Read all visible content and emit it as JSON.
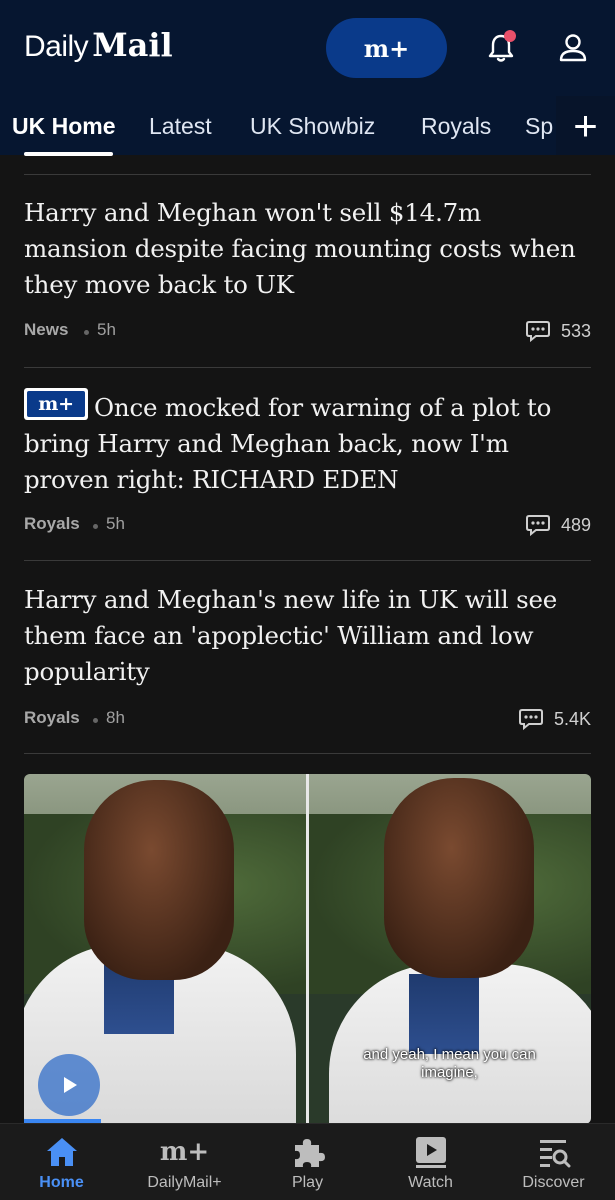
{
  "header": {
    "logo_daily": "Daily",
    "logo_mail": "Mail",
    "mplus_label": "m+"
  },
  "tabs": [
    {
      "label": "UK Home",
      "active": true
    },
    {
      "label": "Latest"
    },
    {
      "label": "UK Showbiz"
    },
    {
      "label": "Royals"
    },
    {
      "label": "Sp"
    }
  ],
  "add_tab_label": "+",
  "articles": [
    {
      "headline": "Harry and Meghan won't sell $14.7m mansion despite facing mounting costs when they move back to UK",
      "category": "News",
      "time": "5h",
      "comments": "533",
      "premium": false
    },
    {
      "badge": "m+",
      "headline": "Once mocked for warning of a plot to bring Harry and Meghan back, now I'm proven right: RICHARD EDEN",
      "category": "Royals",
      "time": "5h",
      "comments": "489",
      "premium": true
    },
    {
      "headline": "Harry and Meghan's new life in UK will see them face an 'apoplectic' William and low popularity",
      "category": "Royals",
      "time": "8h",
      "comments": "5.4K",
      "premium": false
    }
  ],
  "video": {
    "caption_line1": "and yeah, I mean you can",
    "caption_line2": "imagine,",
    "progress": 0.14
  },
  "bottom_nav": [
    {
      "label": "Home",
      "icon": "home-icon",
      "active": true
    },
    {
      "label": "DailyMail+",
      "icon": "mplus-icon"
    },
    {
      "label": "Play",
      "icon": "puzzle-icon"
    },
    {
      "label": "Watch",
      "icon": "play-square-icon"
    },
    {
      "label": "Discover",
      "icon": "discover-icon"
    }
  ],
  "colors": {
    "header_bg": "#061630",
    "accent_blue": "#0a3a8a",
    "active_nav": "#4a90f5",
    "notification_dot": "#e8506a"
  }
}
